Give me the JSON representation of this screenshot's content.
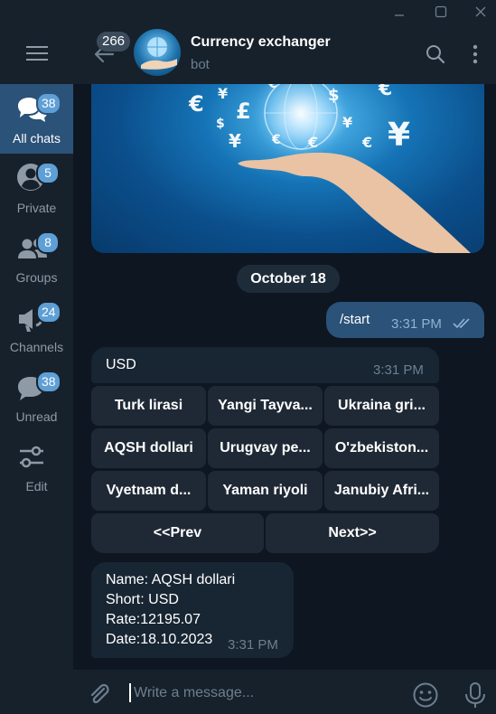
{
  "sidebar": {
    "folders": [
      {
        "label": "All chats",
        "badge": "38",
        "icon": "all-chats-icon"
      },
      {
        "label": "Private",
        "badge": "5",
        "icon": "person-icon"
      },
      {
        "label": "Groups",
        "badge": "8",
        "icon": "group-icon"
      },
      {
        "label": "Channels",
        "badge": "24",
        "icon": "channel-icon"
      },
      {
        "label": "Unread",
        "badge": "38",
        "icon": "unread-icon"
      },
      {
        "label": "Edit",
        "icon": "sliders-icon"
      }
    ]
  },
  "header": {
    "back_badge": "266",
    "title": "Currency exchanger",
    "subtitle": "bot"
  },
  "messages": {
    "date_separator": "October 18",
    "out": {
      "text": "/start",
      "time": "3:31 PM"
    },
    "bot": {
      "text": "USD",
      "time": "3:31 PM"
    },
    "keyboard": {
      "rows": [
        [
          "Turk lirasi",
          "Yangi Tayva...",
          "Ukraina gri..."
        ],
        [
          "AQSH dollari",
          "Urugvay pe...",
          "O'zbekiston..."
        ],
        [
          "Vyetnam d...",
          "Yaman riyoli",
          "Janubiy Afri..."
        ]
      ],
      "prev": "<<Prev",
      "next": "Next>>"
    },
    "info": {
      "name": "Name: AQSH dollari",
      "short": "Short: USD",
      "rate": "Rate:12195.07",
      "date": "Date:18.10.2023",
      "time": "3:31 PM"
    }
  },
  "composer": {
    "placeholder": "Write a message..."
  },
  "colors": {
    "accent": "#5e9fd6",
    "active_folder": "#2b5278",
    "outgoing_bubble": "#2b5278",
    "incoming_bubble": "#182533",
    "background": "#0e1621"
  }
}
